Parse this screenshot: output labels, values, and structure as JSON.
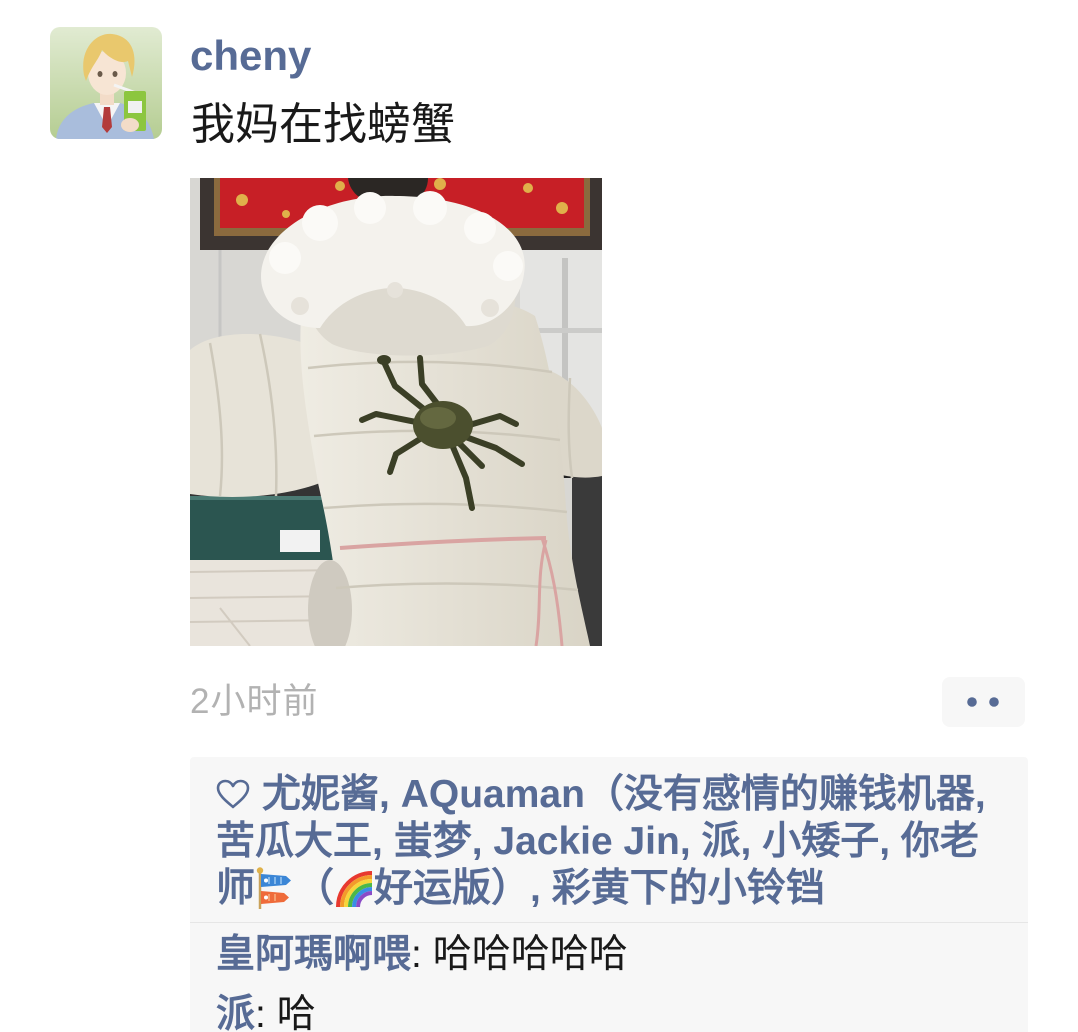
{
  "post": {
    "author": "cheny",
    "text": "我妈在找螃蟹",
    "time": "2小时前"
  },
  "actions": {
    "more_icon": "more-dots-icon"
  },
  "likes": {
    "icon": "heart-outline-icon",
    "separator": ", ",
    "names": [
      "尤妮酱",
      "AQuaman（没有感情的赚钱机器",
      "苦瓜大王",
      "蚩梦",
      "Jackie Jin",
      "派",
      "小矮子",
      {
        "prefix": "你老师",
        "icon_1": "carp-streamer-icon",
        "middle": "（",
        "icon_2": "rainbow-icon",
        "suffix": "好运版）"
      },
      "彩黄下的小铃铛"
    ]
  },
  "comments": {
    "separator": ": ",
    "items": [
      {
        "name": "皇阿瑪啊喂",
        "text": "哈哈哈哈哈"
      },
      {
        "name": "派",
        "text": "哈"
      }
    ]
  },
  "colors": {
    "link": "#576b95",
    "text": "#191919",
    "timestamp": "#b2b2b2",
    "panel_background": "#f7f7f7",
    "divider": "#e6e6e6"
  }
}
